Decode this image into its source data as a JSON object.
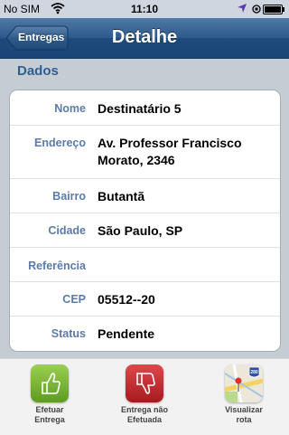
{
  "statusbar": {
    "carrier": "No SIM",
    "time": "11:10"
  },
  "navbar": {
    "back_label": "Entregas",
    "title": "Detalhe"
  },
  "section": {
    "title": "Dados"
  },
  "details": [
    {
      "key": "Nome",
      "value": "Destinatário 5"
    },
    {
      "key": "Endereço",
      "value": "Av. Professor Francisco Morato, 2346"
    },
    {
      "key": "Bairro",
      "value": "Butantã"
    },
    {
      "key": "Cidade",
      "value": "São Paulo, SP"
    },
    {
      "key": "Referência",
      "value": ""
    },
    {
      "key": "CEP",
      "value": "05512--20"
    },
    {
      "key": "Status",
      "value": "Pendente"
    }
  ],
  "toolbar": {
    "efetuar_label": "Efetuar\nEntrega",
    "nao_efetuada_label": "Entrega não\nEfetuada",
    "rota_label": "Visualizar\nrota",
    "map_badge": "280"
  },
  "colors": {
    "navbar": "#2d5a8c",
    "section_header": "#2f5f8f",
    "field_label": "#5c7ba8",
    "success": "#6fa832",
    "danger": "#c0282c"
  },
  "icons": {
    "efetuar": "thumbs-up-icon",
    "nao_efetuada": "thumbs-down-icon",
    "rota": "map-icon"
  }
}
